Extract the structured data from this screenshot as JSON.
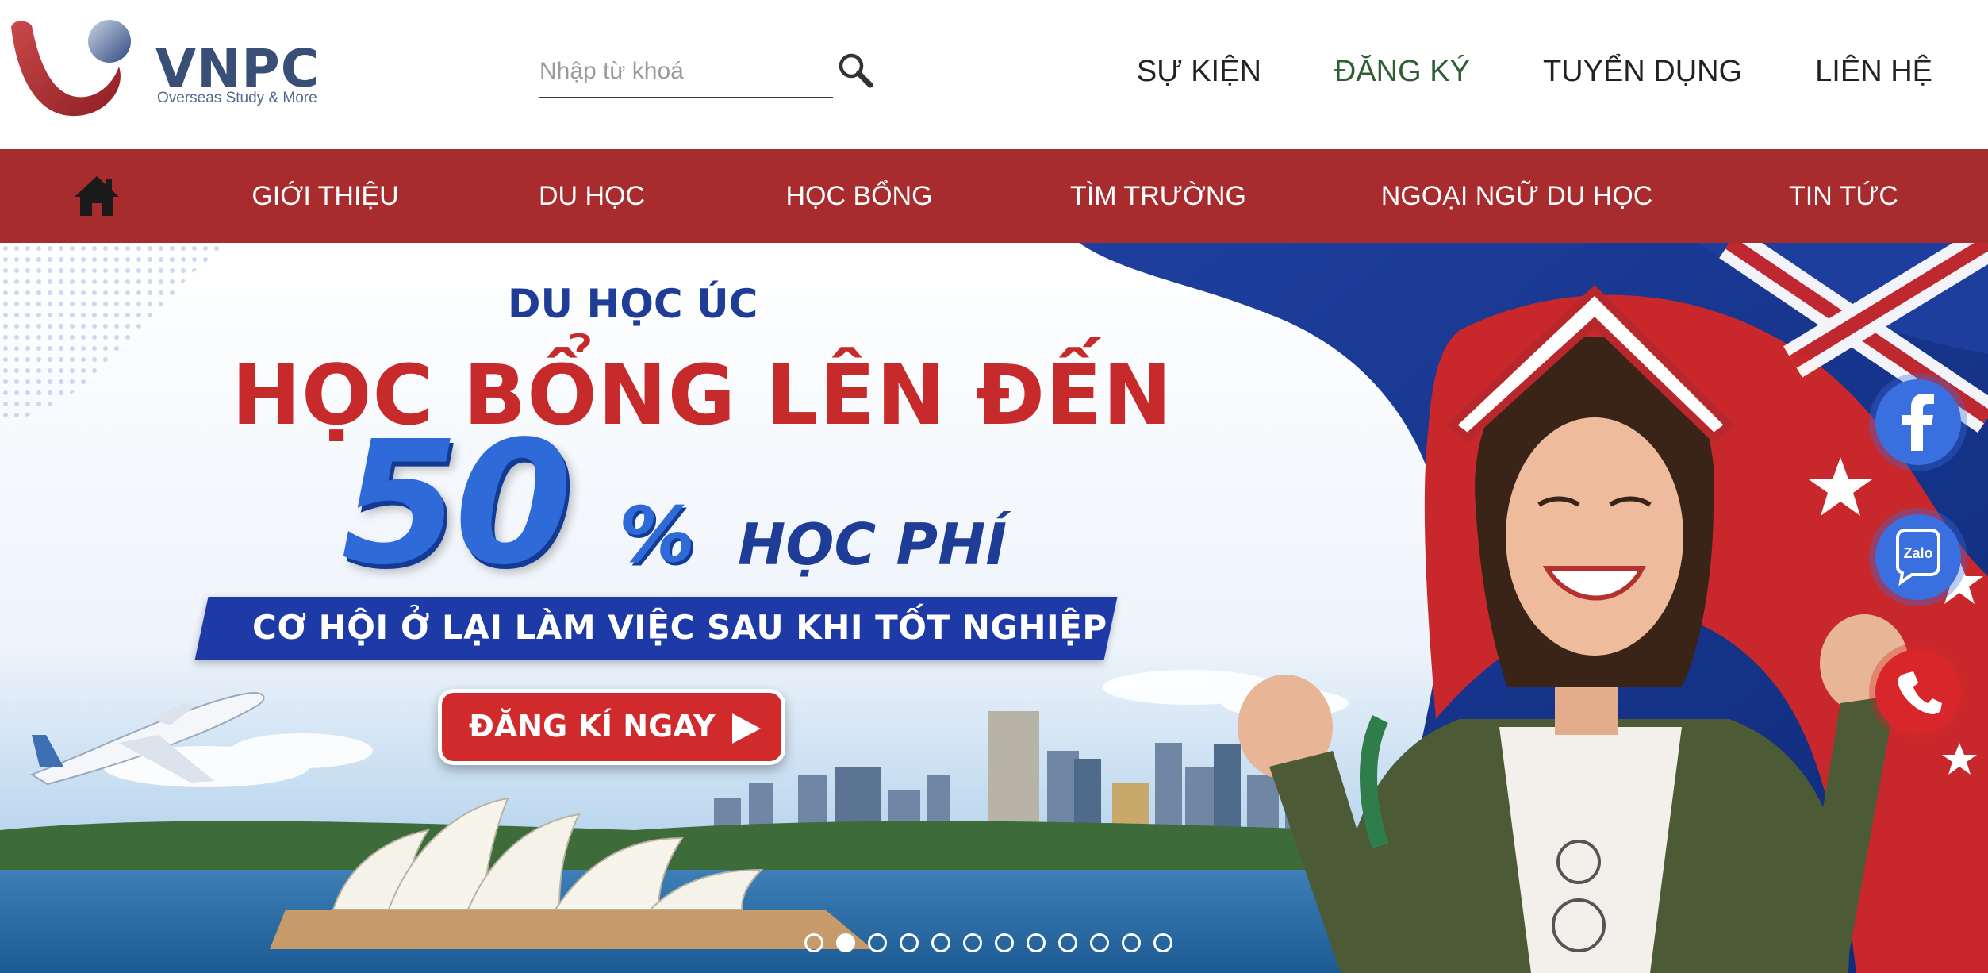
{
  "brand": {
    "name": "VNPC",
    "tagline": "Overseas Study & More"
  },
  "search": {
    "placeholder": "Nhập từ khoá",
    "icon": "search-icon"
  },
  "top_nav": [
    {
      "label": "SỰ KIỆN",
      "active": false
    },
    {
      "label": "ĐĂNG KÝ",
      "active": true
    },
    {
      "label": "TUYỂN DỤNG",
      "active": false
    },
    {
      "label": "LIÊN HỆ",
      "active": false
    }
  ],
  "main_nav": {
    "home_icon": "home-icon",
    "items": [
      {
        "label": "GIỚI THIỆU"
      },
      {
        "label": "DU HỌC"
      },
      {
        "label": "HỌC BỔNG"
      },
      {
        "label": "TÌM TRƯỜNG"
      },
      {
        "label": "NGOẠI NGỮ DU HỌC"
      },
      {
        "label": "TIN TỨC"
      }
    ]
  },
  "hero": {
    "subtitle": "DU HỌC ÚC",
    "headline": "HỌC BỔNG LÊN ĐẾN",
    "percent_value": "50",
    "percent_sign": "%",
    "fee_label": "HỌC PHÍ",
    "ribbon": "CƠ HỘI Ở LẠI LÀM VIỆC SAU KHI TỐT NGHIỆP",
    "cta_label": "ĐĂNG KÍ NGAY"
  },
  "social": {
    "zalo_label": "Zalo"
  },
  "slider": {
    "total": 12,
    "active_index": 1
  },
  "colors": {
    "nav_red": "#a82c2e",
    "active_link_green": "#2f5e34",
    "brand_navy": "#3a4f76",
    "hero_red": "#c62a2b",
    "hero_blue": "#1f3d97",
    "facebook_blue": "#3a6fe0",
    "phone_red": "#d9262b"
  }
}
